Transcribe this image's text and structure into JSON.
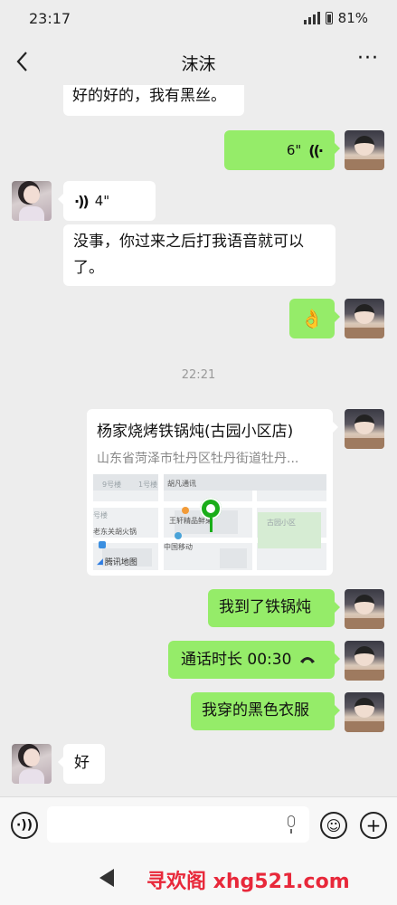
{
  "status_bar": {
    "time": "23:17",
    "battery": "81%"
  },
  "header": {
    "title": "沫沫",
    "more_label": "···"
  },
  "messages": {
    "m1": "好的好的，我有黑丝。",
    "m2_duration": "6\"",
    "m3_duration": "4\"",
    "m4": "没事，你过来之后打我语音就可以了。",
    "m5": "👌",
    "timestamp": "22:21",
    "m7": "我到了铁锅炖",
    "m8": "通话时长 00:30",
    "m9": "我穿的黑色衣服",
    "m10": "好"
  },
  "location_card": {
    "name": "杨家烧烤铁锅炖(古园小区店)",
    "address": "山东省菏泽市牡丹区牡丹街道牡丹...",
    "map_labels": {
      "building_9": "9号楼",
      "building_1": "1号楼",
      "hupan": "胡凡通讯",
      "building_label": "号楼",
      "wangxuan": "王轩精品鲜果",
      "guyuan": "古园小区",
      "hotpot": "老东关胡火锅",
      "mobile": "中国移动"
    },
    "map_provider": "腾讯地图"
  },
  "input_bar": {
    "placeholder": ""
  },
  "watermark": "寻欢阁 xhg521.com",
  "icons": {
    "back": "chevron-left-icon",
    "voice_wave": "voice-wave-icon",
    "hangup": "phone-hangup-icon",
    "emoji": "emoji-icon",
    "add": "plus-icon",
    "mic": "mic-icon"
  },
  "colors": {
    "outgoing_bubble": "#95ec69",
    "incoming_bubble": "#ffffff",
    "background": "#ededed",
    "pin": "#1aad19"
  }
}
